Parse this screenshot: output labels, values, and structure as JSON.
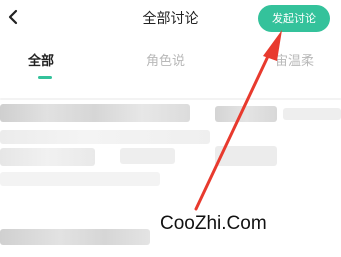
{
  "header": {
    "title": "全部讨论",
    "start_button_label": "发起讨论"
  },
  "tabs": [
    {
      "label": "全部",
      "active": true
    },
    {
      "label": "角色说",
      "active": false
    },
    {
      "label": "宙温柔",
      "active": false
    }
  ],
  "watermark": "CooZhi.Com",
  "colors": {
    "accent": "#34c29b",
    "arrow": "#e83a2e"
  },
  "icons": {
    "back": "chevron-left-icon"
  }
}
